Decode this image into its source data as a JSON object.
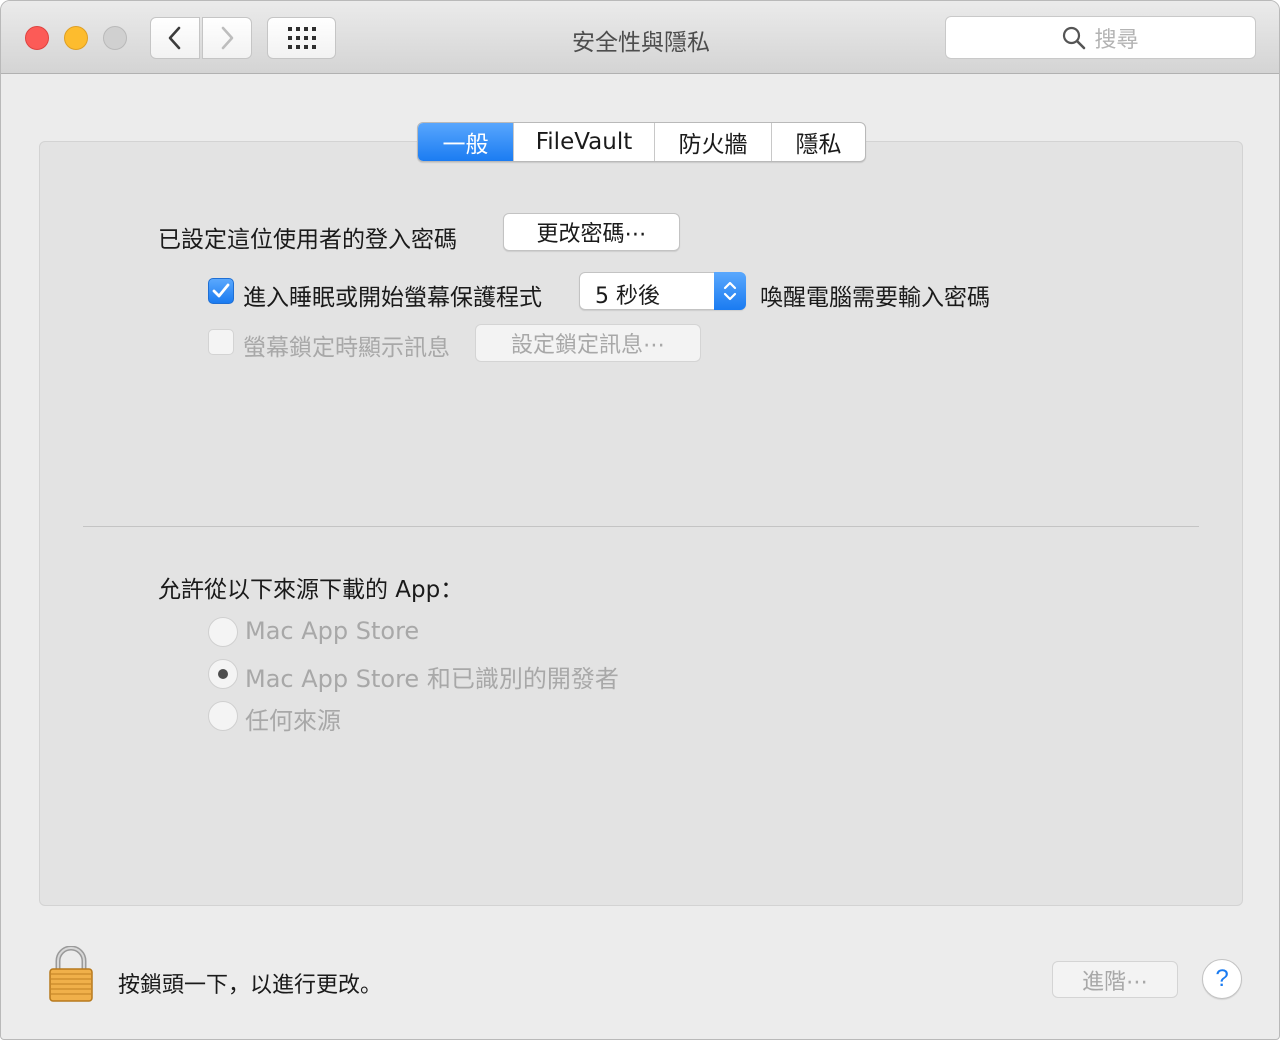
{
  "window": {
    "title": "安全性與隱私",
    "search_placeholder": "搜尋"
  },
  "tabs": [
    {
      "label": "一般",
      "active": true
    },
    {
      "label": "FileVault",
      "active": false
    },
    {
      "label": "防火牆",
      "active": false
    },
    {
      "label": "隱私",
      "active": false
    }
  ],
  "general": {
    "password_set_label": "已設定這位使用者的登入密碼",
    "change_password_button": "更改密碼⋯",
    "require_password_checkbox": {
      "label": "進入睡眠或開始螢幕保護程式",
      "checked": true
    },
    "require_password_delay": "5 秒後",
    "require_password_suffix": "喚醒電腦需要輸入密碼",
    "show_message_checkbox": {
      "label": "螢幕鎖定時顯示訊息",
      "checked": false,
      "enabled": false
    },
    "set_lock_message_button": "設定鎖定訊息⋯"
  },
  "downloads": {
    "label": "允許從以下來源下載的 App：",
    "options": [
      {
        "label": "Mac App Store",
        "selected": false
      },
      {
        "label": "Mac App Store 和已識別的開發者",
        "selected": true
      },
      {
        "label": "任何來源",
        "selected": false
      }
    ]
  },
  "footer": {
    "lock_text": "按鎖頭一下，以進行更改。",
    "advanced_button": "進階⋯",
    "help_button": "?"
  },
  "colors": {
    "accent": "#1a7bf1",
    "close": "#fc5b57",
    "minimize": "#fdbc2e"
  }
}
